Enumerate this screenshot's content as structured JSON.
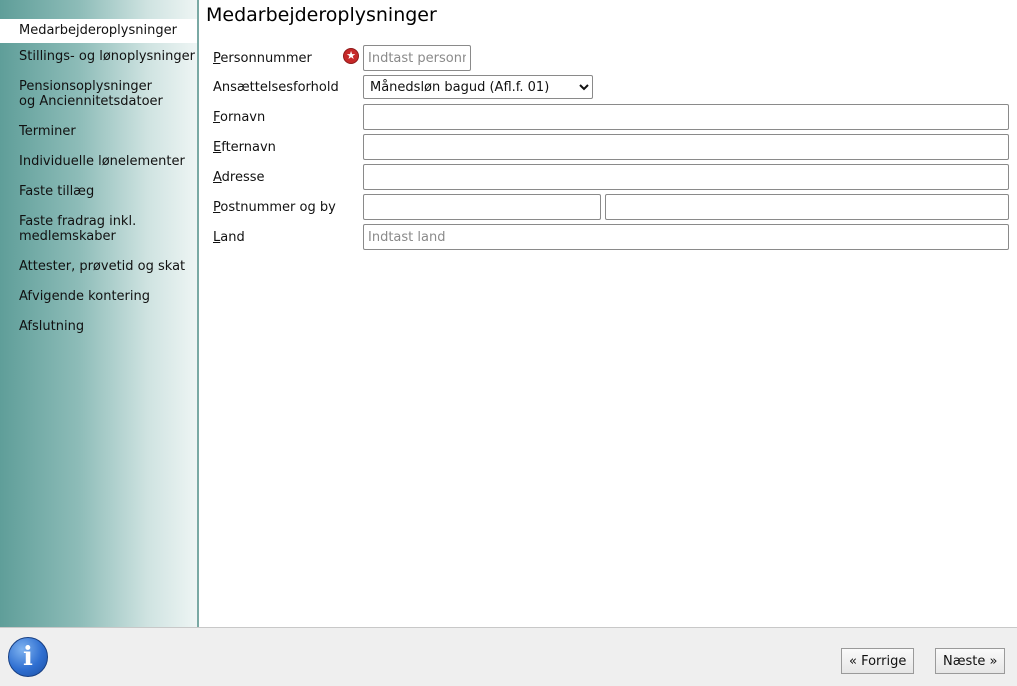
{
  "sidebar": {
    "items": [
      {
        "label": "Medarbejderoplysninger"
      },
      {
        "label": "Stillings- og lønoplysninger"
      },
      {
        "label": "Pensionsoplysninger og Anciennitetsdatoer"
      },
      {
        "label": "Terminer"
      },
      {
        "label": "Individuelle lønelementer"
      },
      {
        "label": "Faste tillæg"
      },
      {
        "label": "Faste fradrag inkl. medlemskaber"
      },
      {
        "label": "Attester, prøvetid og skat"
      },
      {
        "label": "Afvigende kontering"
      },
      {
        "label": "Afslutning"
      }
    ]
  },
  "main": {
    "title": "Medarbejderoplysninger",
    "form": {
      "personnummer": {
        "label_first": "P",
        "label_rest": "ersonnummer",
        "placeholder": "Indtast personnummer",
        "value": "",
        "required_icon": "required-star-icon"
      },
      "ansaettelse": {
        "label": "Ansættelsesforhold",
        "selected": "Månedsløn bagud (Afl.f. 01)"
      },
      "fornavn": {
        "label_first": "F",
        "label_rest": "ornavn",
        "value": ""
      },
      "efternavn": {
        "label_first": "E",
        "label_rest": "fternavn",
        "value": ""
      },
      "adresse": {
        "label_first": "A",
        "label_rest": "dresse",
        "value": ""
      },
      "postnummer": {
        "label_first": "P",
        "label_rest": "ostnummer og by",
        "postnr_value": "",
        "by_value": ""
      },
      "land": {
        "label_first": "L",
        "label_rest": "and",
        "placeholder": "Indtast land",
        "value": ""
      }
    }
  },
  "footer": {
    "info_icon": "info-icon",
    "prev_label": "« Forrige",
    "next_label": "Næste »"
  }
}
